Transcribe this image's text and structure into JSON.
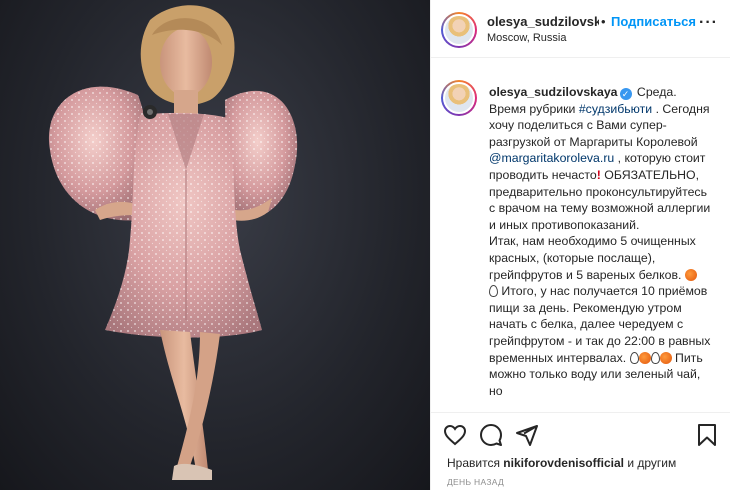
{
  "post": {
    "username": "olesya_sudzilovskaya",
    "follow_label": "Подписаться",
    "separator": "•",
    "location": "Moscow, Russia",
    "more_label": "···"
  },
  "caption": {
    "username": "olesya_sudzilovskaya",
    "verified_mark": "✓",
    "part1": " Среда. Время рубрики ",
    "hashtag": "#судзибьюти",
    "part2": " . Сегодня хочу поделиться с Вами супер-разгрузкой от Маргариты Королевой ",
    "mention": "@margaritakoroleva.ru",
    "part3": " , которую стоит проводить нечасто",
    "excl": "!",
    "part4": " ОБЯЗАТЕЛЬНО, предварительно проконсультируйтесь с врачом на тему возможной аллергии и иных противопоказаний.\nИтак, нам необходимо 5 очищенных красных, (которые послаще), грейпфрутов и 5 вареных белков. ",
    "part5": " Итого, у нас получается 10 приёмов пищи за день. Рекомендую утром начать с белка, далее чередуем с грейпфрутом - и так до 22:00 в равных временных интервалах. ",
    "part6": " Пить можно только воду или зеленый чай, но"
  },
  "icons": {
    "like": "heart-icon",
    "comment": "comment-icon",
    "share": "share-icon",
    "save": "bookmark-icon",
    "emoji_orange": "orange-emoji",
    "emoji_egg": "egg-emoji"
  },
  "likes": {
    "prefix": "Нравится ",
    "user": "nikiforovdenisofficial",
    "suffix": " и другим"
  },
  "timestamp": "День назад",
  "colors": {
    "link": "#00376b",
    "follow": "#0095f6",
    "verified": "#3897f0",
    "dress": "#e4b3b4"
  }
}
